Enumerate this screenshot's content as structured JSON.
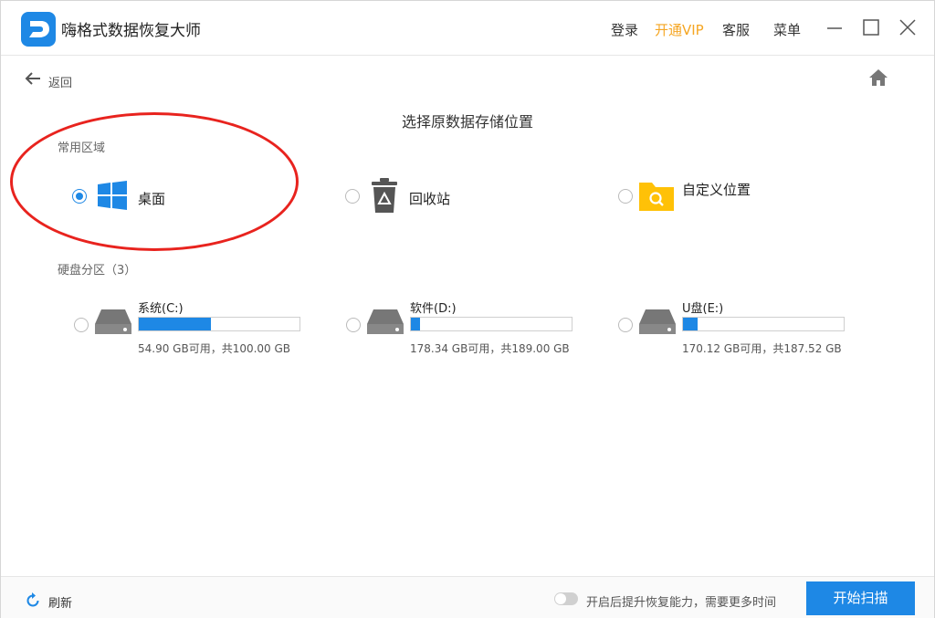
{
  "app": {
    "title": "嗨格式数据恢复大师"
  },
  "header": {
    "login": "登录",
    "vip": "开通VIP",
    "service": "客服",
    "menu": "菜单"
  },
  "nav": {
    "back": "返回"
  },
  "page": {
    "title": "选择原数据存储位置"
  },
  "common": {
    "label": "常用区域",
    "options": [
      {
        "label": "桌面",
        "selected": true,
        "icon": "windows-icon"
      },
      {
        "label": "回收站",
        "selected": false,
        "icon": "recycle-bin-icon"
      },
      {
        "label": "自定义位置",
        "selected": false,
        "icon": "folder-search-icon"
      }
    ]
  },
  "drives": {
    "label": "硬盘分区（3）",
    "items": [
      {
        "name": "系统(C:)",
        "info": "54.90 GB可用，共100.00 GB",
        "used_fraction": 0.451
      },
      {
        "name": "软件(D:)",
        "info": "178.34 GB可用，共189.00 GB",
        "used_fraction": 0.056
      },
      {
        "name": "U盘(E:)",
        "info": "170.12 GB可用，共187.52 GB",
        "used_fraction": 0.093
      }
    ]
  },
  "footer": {
    "refresh": "刷新",
    "toggle_label": "开启后提升恢复能力，需要更多时间",
    "scan": "开始扫描"
  },
  "colors": {
    "accent": "#1e88e5",
    "vip": "#f5a623",
    "folder": "#ffc107",
    "annotation": "#e8231e"
  }
}
